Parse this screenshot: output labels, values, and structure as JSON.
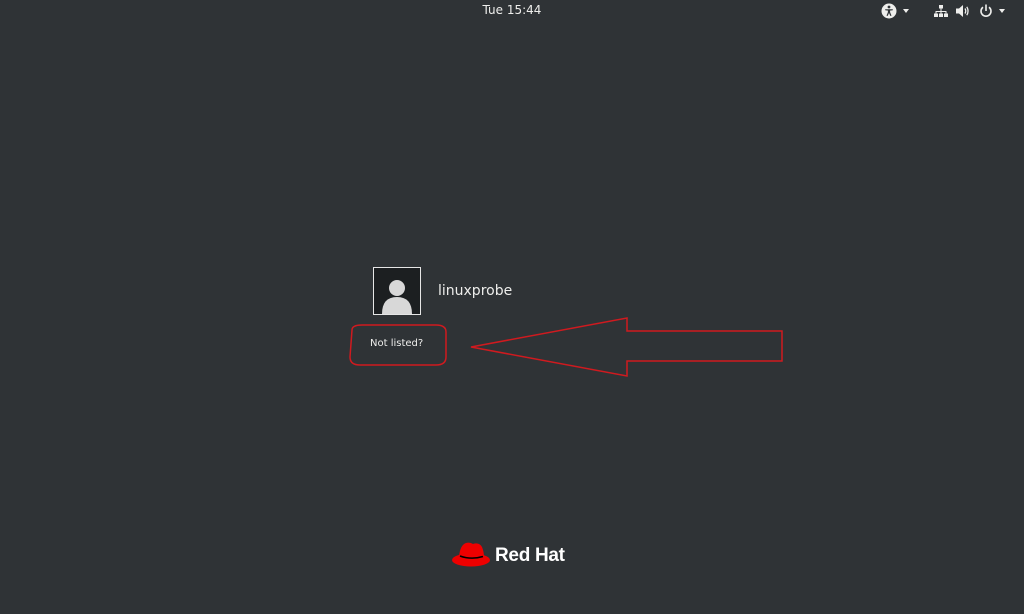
{
  "topbar": {
    "clock": "Tue 15:44",
    "icons": {
      "accessibility": "accessibility-icon",
      "network": "network-wired-icon",
      "volume": "volume-icon",
      "power": "power-icon"
    }
  },
  "login": {
    "users": [
      {
        "username": "linuxprobe",
        "avatar": "default-user-avatar-icon"
      }
    ],
    "not_listed_label": "Not listed?"
  },
  "branding": {
    "logo_text": "Red Hat",
    "logo_color": "#ee0000"
  },
  "annotations": {
    "color": "#d01a1f",
    "shapes": [
      "circle-highlight",
      "arrow-left"
    ]
  },
  "colors": {
    "background": "#2f3336",
    "text": "#eeeeec"
  }
}
